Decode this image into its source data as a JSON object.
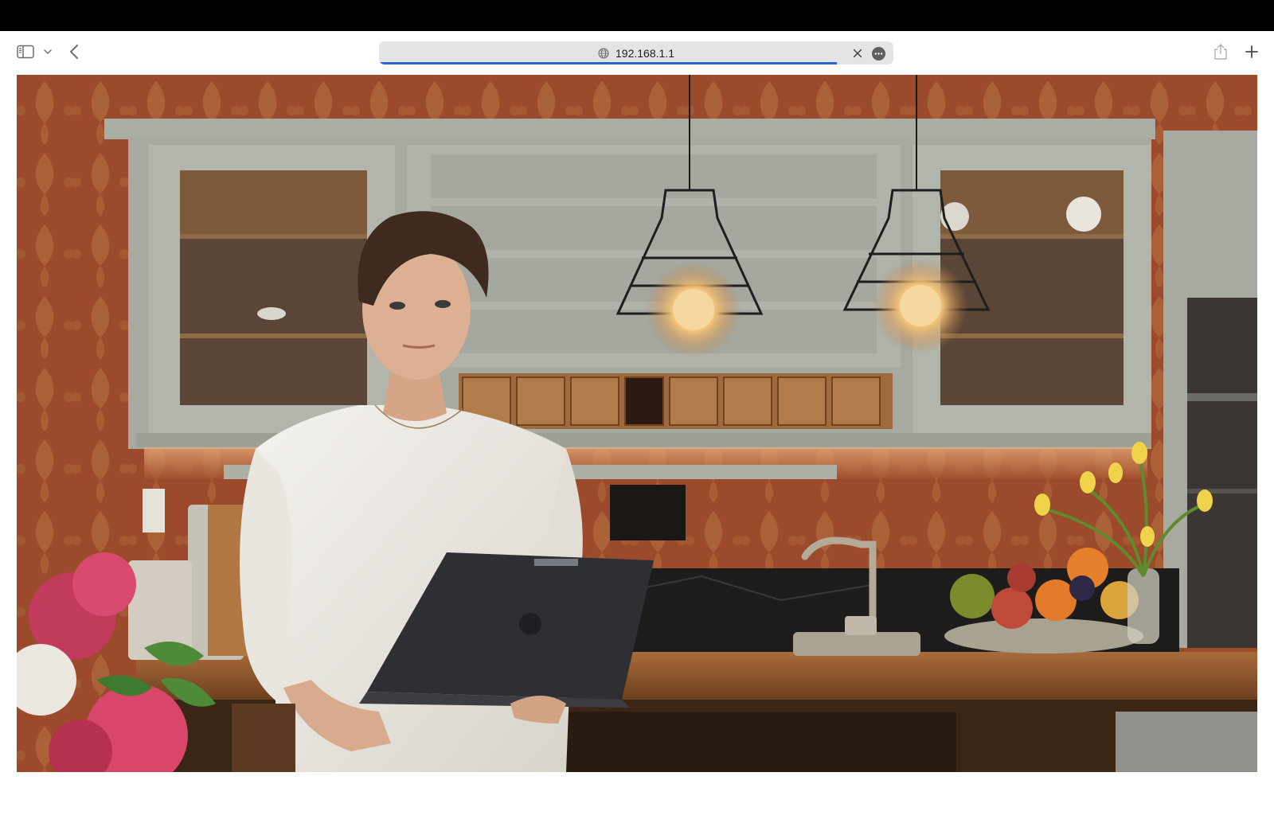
{
  "browser": {
    "url": "192.168.1.1",
    "load_progress": 0.89,
    "accent_color": "#2f62d3",
    "icons": {
      "sidebar": "sidebar-icon",
      "sidebar_menu": "chevron-down-icon",
      "back": "chevron-left-icon",
      "site": "globe-icon",
      "clear": "close-icon",
      "more": "ellipsis-circle-icon",
      "share": "share-icon",
      "new_tab": "plus-icon"
    }
  },
  "page": {
    "image_subject": "kitchen-photo"
  }
}
